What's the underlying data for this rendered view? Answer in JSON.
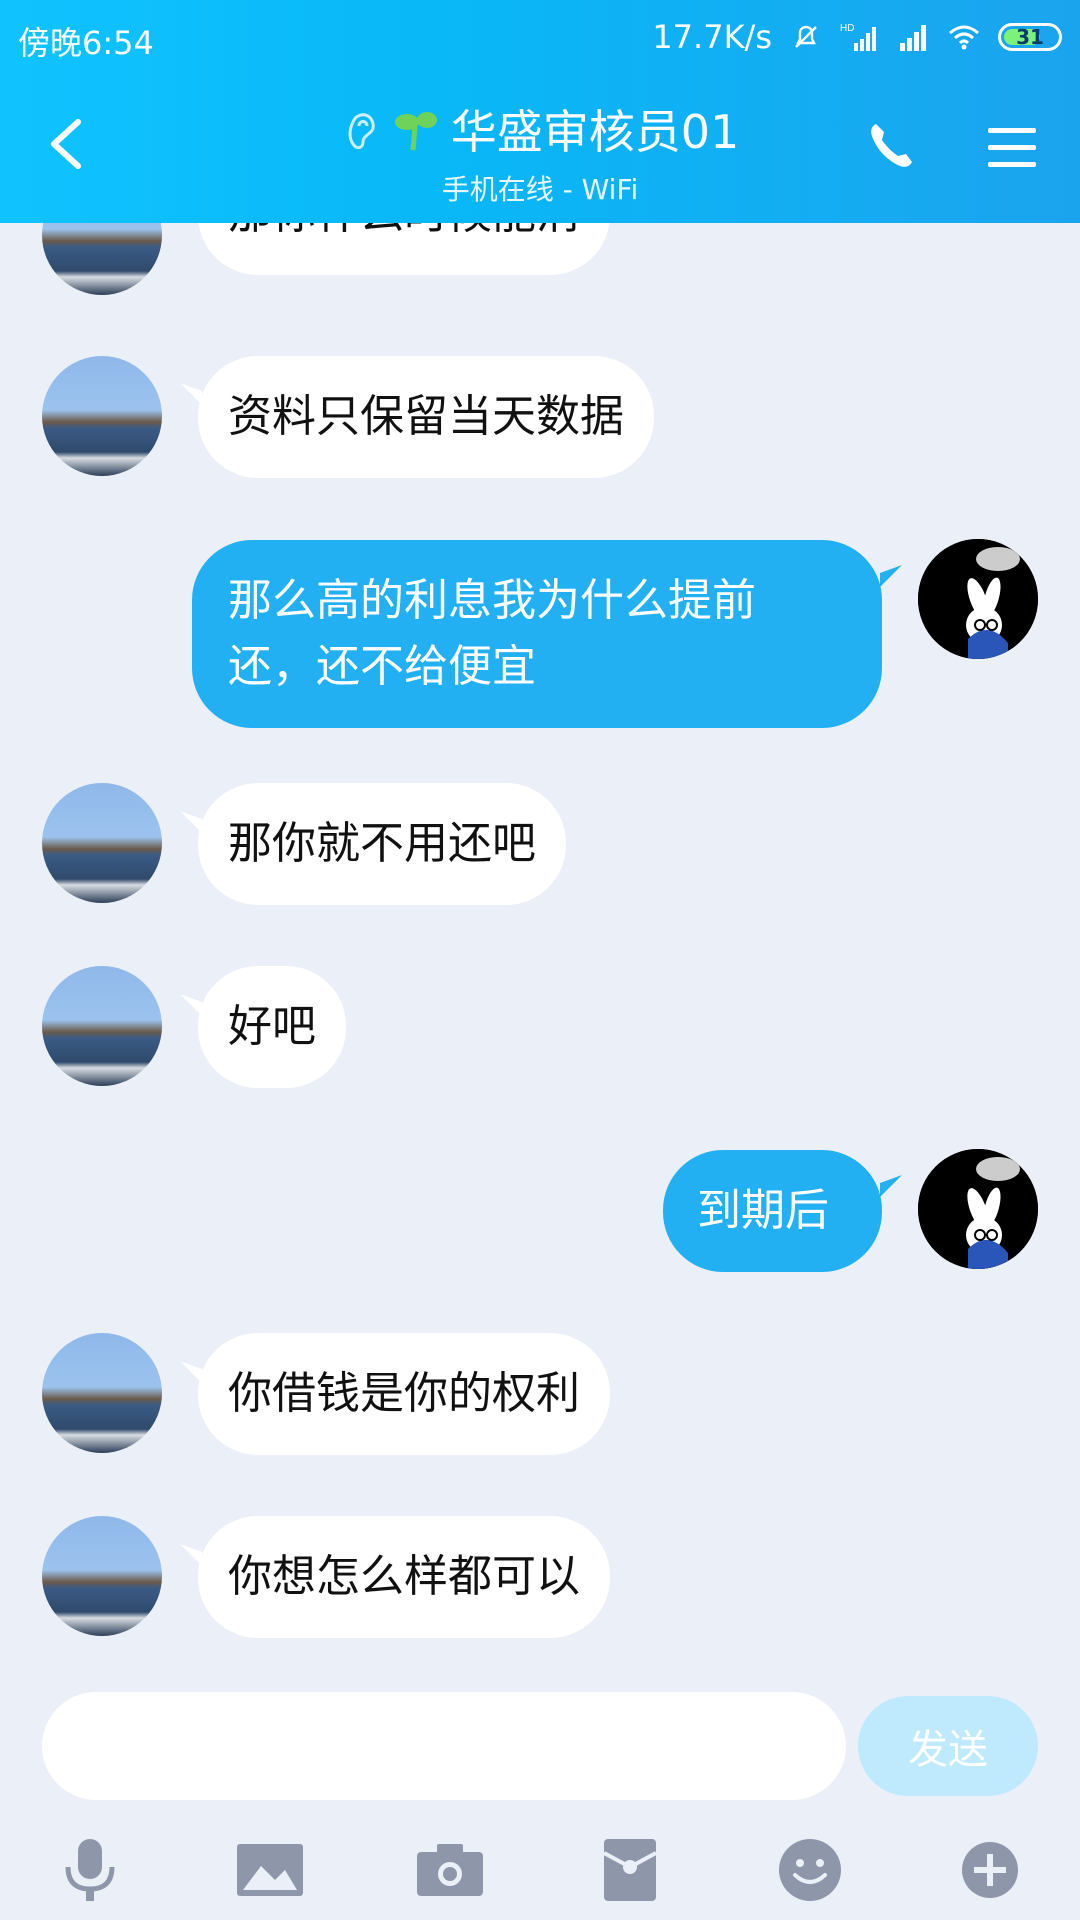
{
  "status_bar": {
    "time": "傍晚6:54",
    "speed": "17.7K/s",
    "battery": "31"
  },
  "header": {
    "title": "华盛审核员01",
    "subtitle": "手机在线 - WiFi"
  },
  "messages": [
    {
      "side": "other",
      "text": "那你什么时候能消"
    },
    {
      "side": "other",
      "text": "资料只保留当天数据"
    },
    {
      "side": "me",
      "text_line1": "那么高的利息我为什么提前",
      "text_line2": "还，还不给便宜"
    },
    {
      "side": "other",
      "text": "那你就不用还吧"
    },
    {
      "side": "other",
      "text": "好吧"
    },
    {
      "side": "me",
      "text": "到期后"
    },
    {
      "side": "other",
      "text": "你借钱是你的权利"
    },
    {
      "side": "other",
      "text": "你想怎么样都可以"
    }
  ],
  "input": {
    "send_label": "发送"
  },
  "toolbar": {
    "items": [
      "mic-icon",
      "image-icon",
      "camera-icon",
      "red-packet-icon",
      "emoji-icon",
      "plus-icon"
    ]
  },
  "colors": {
    "header_start": "#10c3ff",
    "header_end": "#1ba4ee",
    "my_bubble": "#23b0f2",
    "bg": "#ebeff7",
    "send_disabled": "#bfeafd"
  }
}
